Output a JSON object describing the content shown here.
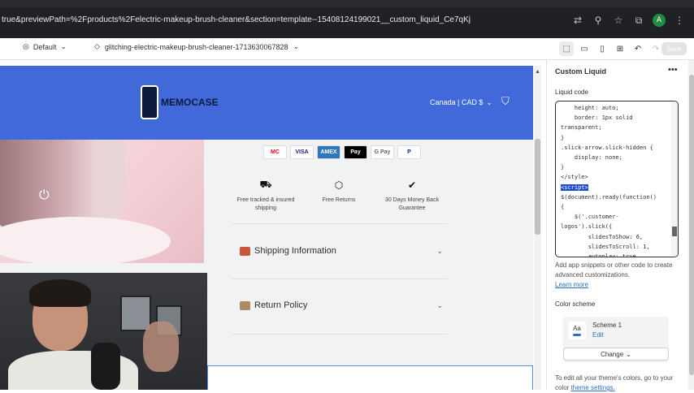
{
  "browser": {
    "url": "true&previewPath=%2Fproducts%2Felectric-makeup-brush-cleaner&section=template--15408124199021__custom_liquid_Ce7qKj",
    "profile_initial": "A"
  },
  "editor": {
    "theme_name": "Default",
    "page_name": "glitching-electric-makeup-brush-cleaner-1713630067828",
    "save_label": "Save"
  },
  "store": {
    "brand": "MEMOCASE",
    "currency": "Canada | CAD $",
    "payment_methods": [
      "MC",
      "VISA",
      "AMEX",
      "Pay",
      "G Pay",
      "P"
    ],
    "features": [
      {
        "icon": "truck-icon",
        "label": "Free tracked & insured shipping"
      },
      {
        "icon": "box-icon",
        "label": "Free Returns"
      },
      {
        "icon": "check-circle-icon",
        "label": "30 Days Money Back Guarantee"
      }
    ],
    "accordions": [
      {
        "icon": "truck-icon",
        "label": "Shipping Information"
      },
      {
        "icon": "box-icon",
        "label": "Return Policy"
      }
    ]
  },
  "sidebar": {
    "title": "Custom Liquid",
    "field_label": "Liquid code",
    "code_lines": [
      "    height: auto;",
      "    border: 1px solid",
      "transparent;",
      "}",
      ".slick-arrow.slick-hidden {",
      "    display: none;",
      "}",
      "</style>",
      "<script>",
      "$(document).ready(function()",
      "{",
      "    $('.customer-",
      "logos').slick({",
      "        slidesToShow: 6,",
      "        slidesToScroll: 1,",
      "        autoplay: true,"
    ],
    "help_text": "Add app snippets or other code to create advanced customizations.",
    "help_link": "Learn more",
    "color_scheme_label": "Color scheme",
    "scheme_swatch_text": "Aa",
    "scheme_name": "Scheme 1",
    "scheme_edit": "Edit",
    "change_label": "Change",
    "footer_text": "To edit all your theme's colors, go to your color",
    "footer_link": "theme settings."
  },
  "colors": {
    "header_blue": "#4169d9",
    "brand_navy": "#0d1b3e",
    "selection_blue": "#1f4fcf",
    "link_blue": "#2c6ecb"
  }
}
